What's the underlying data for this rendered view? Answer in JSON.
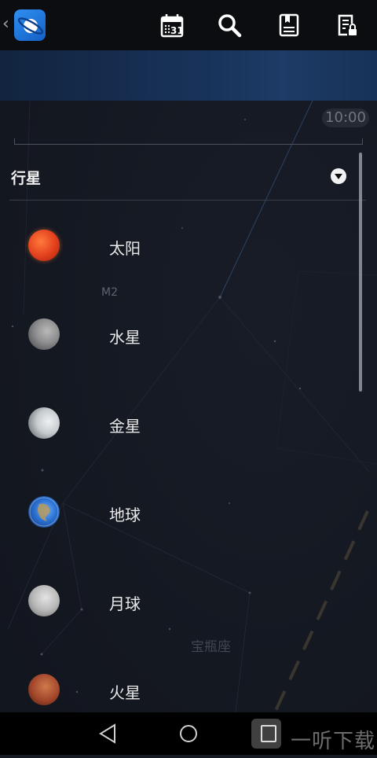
{
  "toolbar": {
    "calendar_day": "31",
    "icons": [
      "back-chevron-icon",
      "app-logo",
      "calendar-icon",
      "search-icon",
      "bookmark-icon",
      "notes-lock-icon"
    ]
  },
  "time_badge": "10:00",
  "sky_labels": {
    "m2": "M2",
    "constellation": "宝瓶座"
  },
  "category": {
    "title": "行星",
    "toggle_icon": "chevron-down-circle-icon"
  },
  "planets": [
    {
      "label": "太阳",
      "icon": "sun-icon",
      "color": "#e0451e"
    },
    {
      "label": "水星",
      "icon": "mercury-icon",
      "color": "#8b8c8e"
    },
    {
      "label": "金星",
      "icon": "venus-icon",
      "color": "#c9cfd2"
    },
    {
      "label": "地球",
      "icon": "earth-icon",
      "color": "#2a6fd0"
    },
    {
      "label": "月球",
      "icon": "moon-icon",
      "color": "#bdbdbd"
    },
    {
      "label": "火星",
      "icon": "mars-icon",
      "color": "#a1452a"
    }
  ],
  "nav": {
    "icons": [
      "back-triangle-icon",
      "home-circle-icon",
      "recents-square-icon"
    ]
  },
  "watermark": "一听下载"
}
